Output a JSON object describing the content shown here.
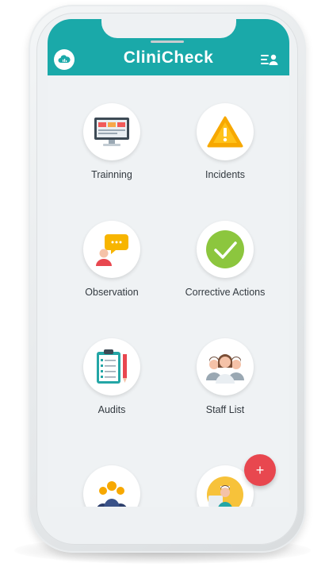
{
  "app": {
    "title": "CliniCheck"
  },
  "header": {
    "left_icon": "cloud-icon",
    "right_icon": "user-list-icon"
  },
  "tiles": [
    {
      "label": "Trainning",
      "icon": "monitor-icon"
    },
    {
      "label": "Incidents",
      "icon": "warning-icon"
    },
    {
      "label": "Observation",
      "icon": "speech-bubble-icon"
    },
    {
      "label": "Corrective Actions",
      "icon": "checkmark-icon"
    },
    {
      "label": "Audits",
      "icon": "clipboard-icon"
    },
    {
      "label": "Staff List",
      "icon": "staff-group-icon"
    },
    {
      "label": "",
      "icon": "team-icon"
    },
    {
      "label": "",
      "icon": "nurse-icon"
    }
  ],
  "fab": {
    "label": "+",
    "icon": "plus-icon"
  },
  "colors": {
    "header": "#1aa9a9",
    "fab": "#e8474f",
    "background": "#eff2f4"
  }
}
